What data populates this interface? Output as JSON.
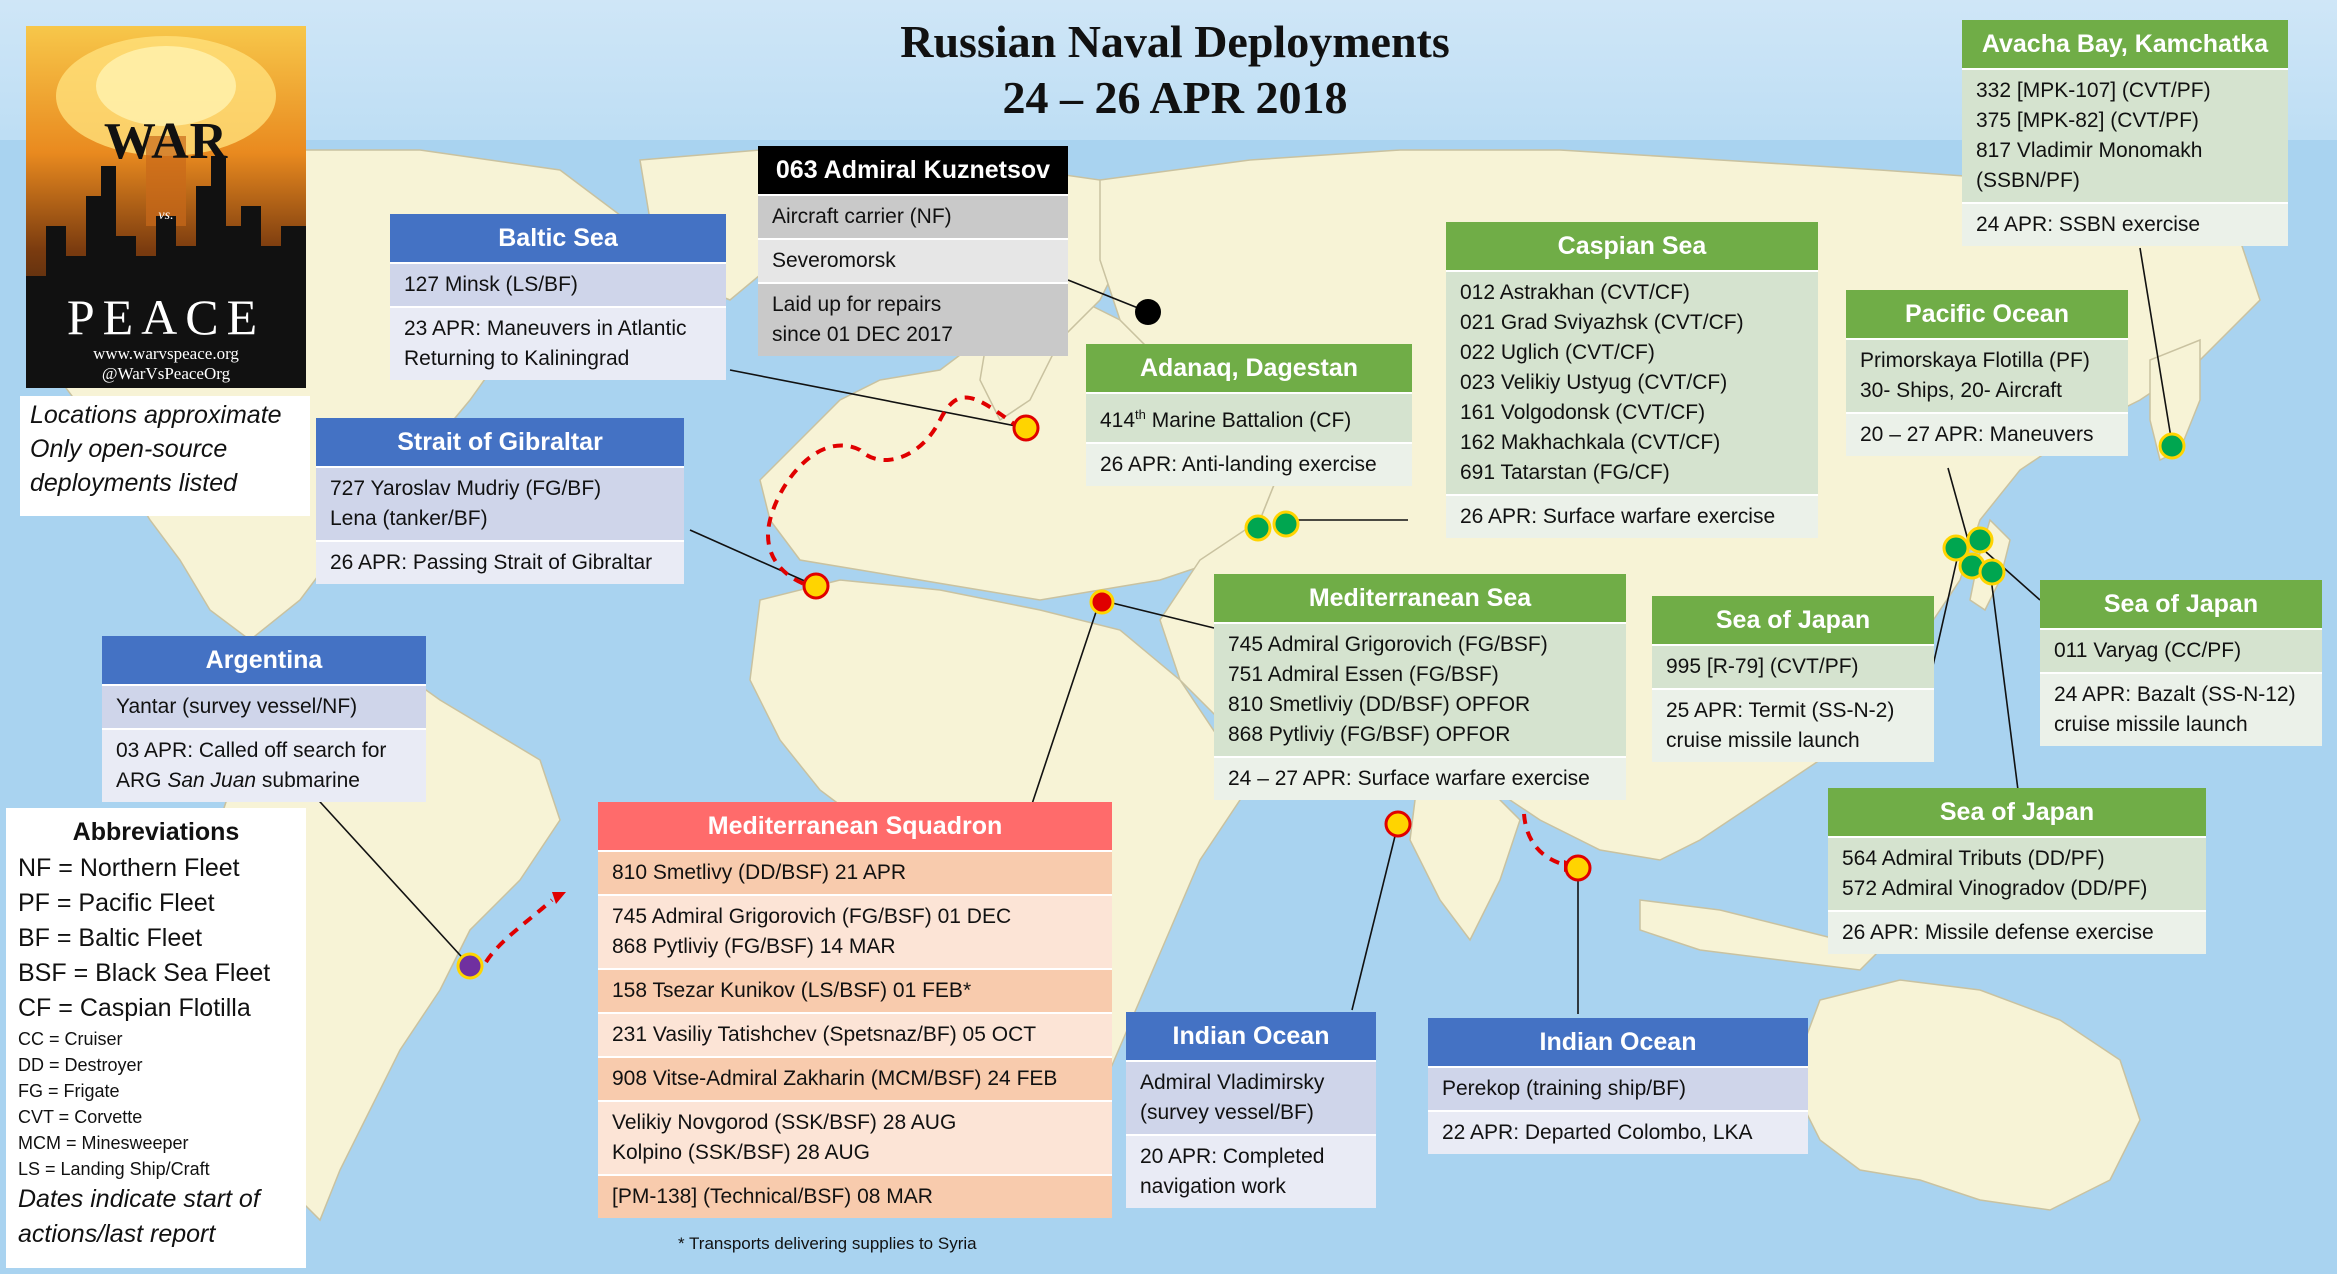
{
  "title": {
    "line1": "Russian Naval Deployments",
    "line2": "24 – 26 APR 2018"
  },
  "logo": {
    "war": "WAR",
    "vs": "vs.",
    "peace": "PEACE",
    "url1": "www.warvspeace.org",
    "url2": "@WarVsPeaceOrg"
  },
  "notes": {
    "line1": "Locations approximate",
    "line2": "Only open-source",
    "line3": "deployments listed"
  },
  "abbreviations": {
    "heading": "Abbreviations",
    "fleets": [
      "NF = Northern Fleet",
      "PF = Pacific Fleet",
      "BF = Baltic Fleet",
      "BSF = Black Sea Fleet",
      "CF = Caspian Flotilla"
    ],
    "types": [
      "CC = Cruiser",
      "DD = Destroyer",
      "FG = Frigate",
      "CVT = Corvette",
      "MCM = Minesweeper",
      "LS = Landing Ship/Craft"
    ],
    "footer1": "Dates indicate start of",
    "footer2": "actions/last report"
  },
  "boxes": {
    "kuznetsov": {
      "header": "063 Admiral Kuznetsov",
      "type": "Aircraft carrier (NF)",
      "location": "Severomorsk",
      "status1": "Laid up for repairs",
      "status2": "since 01 DEC 2017"
    },
    "baltic": {
      "header": "Baltic Sea",
      "ship": "127 Minsk (LS/BF)",
      "event1": "23 APR: Maneuvers in Atlantic",
      "event2": "Returning to Kaliningrad"
    },
    "gibraltar": {
      "header": "Strait of Gibraltar",
      "ship1": "727 Yaroslav Mudriy (FG/BF)",
      "ship2": "Lena (tanker/BF)",
      "event": "26 APR: Passing Strait of Gibraltar"
    },
    "argentina": {
      "header": "Argentina",
      "ship": "Yantar (survey vessel/NF)",
      "event1": "03 APR: Called off search for",
      "event2_pre": "ARG ",
      "event2_italic": "San Juan",
      "event2_post": " submarine"
    },
    "adanaq": {
      "header": "Adanaq, Dagestan",
      "unit_num": "414",
      "unit_sup": "th",
      "unit_rest": " Marine Battalion (CF)",
      "event": "26 APR: Anti-landing exercise"
    },
    "caspian": {
      "header": "Caspian Sea",
      "ships": [
        "012 Astrakhan (CVT/CF)",
        "021 Grad Sviyazhsk (CVT/CF)",
        "022 Uglich (CVT/CF)",
        "023 Velikiy Ustyug (CVT/CF)",
        "161 Volgodonsk (CVT/CF)",
        "162 Makhachkala (CVT/CF)",
        "691 Tatarstan (FG/CF)"
      ],
      "event": "26 APR: Surface warfare exercise"
    },
    "avacha": {
      "header": "Avacha Bay, Kamchatka",
      "ships": [
        "332 [MPK-107] (CVT/PF)",
        "375 [MPK-82] (CVT/PF)",
        "817 Vladimir Monomakh",
        "(SSBN/PF)"
      ],
      "event": "24 APR: SSBN exercise"
    },
    "pacific": {
      "header": "Pacific Ocean",
      "ship1": "Primorskaya Flotilla (PF)",
      "ship2": "30- Ships, 20- Aircraft",
      "event": "20 – 27 APR: Maneuvers"
    },
    "med": {
      "header": "Mediterranean Sea",
      "ships": [
        "745 Admiral Grigorovich (FG/BSF)",
        "751 Admiral Essen (FG/BSF)",
        "810 Smetliviy (DD/BSF) OPFOR",
        "868 Pytliviy (FG/BSF) OPFOR"
      ],
      "event": "24 – 27 APR: Surface warfare exercise"
    },
    "soj1": {
      "header": "Sea of Japan",
      "ship": "995 [R-79] (CVT/PF)",
      "event1": "25 APR: Termit (SS-N-2)",
      "event2": "cruise missile launch"
    },
    "soj2": {
      "header": "Sea of Japan",
      "ship": "011 Varyag (CC/PF)",
      "event1": "24 APR: Bazalt (SS-N-12)",
      "event2": "cruise missile launch"
    },
    "soj3": {
      "header": "Sea of Japan",
      "ship1": "564 Admiral Tributs (DD/PF)",
      "ship2": "572 Admiral Vinogradov (DD/PF)",
      "event": "26 APR: Missile defense exercise"
    },
    "medsq": {
      "header": "Mediterranean Squadron",
      "rows": [
        [
          "810 Smetlivy (DD/BSF) 21 APR"
        ],
        [
          "745 Admiral Grigorovich (FG/BSF) 01 DEC",
          "868 Pytliviy (FG/BSF) 14 MAR"
        ],
        [
          "158 Tsezar Kunikov (LS/BSF) 01 FEB*"
        ],
        [
          "231 Vasiliy Tatishchev (Spetsnaz/BF) 05 OCT"
        ],
        [
          "908 Vitse-Admiral Zakharin (MCM/BSF) 24 FEB"
        ],
        [
          "Velikiy Novgorod (SSK/BSF) 28 AUG",
          "Kolpino (SSK/BSF) 28 AUG"
        ],
        [
          "[PM-138] (Technical/BSF) 08 MAR"
        ]
      ]
    },
    "indian1": {
      "header": "Indian Ocean",
      "ship1": "Admiral Vladimirsky",
      "ship2": "(survey vessel/BF)",
      "event1": "20 APR: Completed",
      "event2": "navigation work"
    },
    "indian2": {
      "header": "Indian Ocean",
      "ship": "Perekop (training ship/BF)",
      "event": "22 APR: Departed Colombo, LKA"
    }
  },
  "footnote": "* Transports delivering supplies to Syria",
  "colors": {
    "ocean": "#a9d3f0",
    "land": "#f7f3d6",
    "blue_header": "#4472c4",
    "green_header": "#70ad47",
    "red_header": "#ff6b6b",
    "marker_yellow": "#ffd400",
    "marker_green": "#00a650",
    "marker_red": "#e00000",
    "route": "#e00000"
  }
}
